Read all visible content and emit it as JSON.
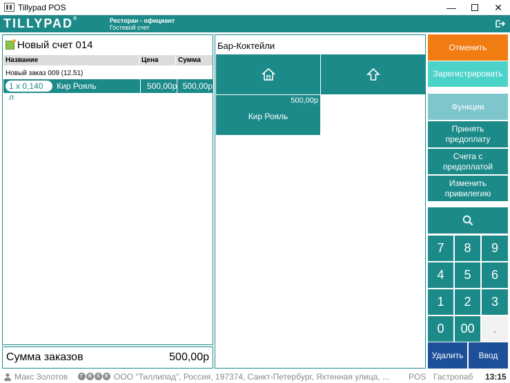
{
  "window": {
    "title": "Tillypad POS"
  },
  "header": {
    "logo": "TILLYPAD",
    "logo_mark": "®",
    "line1": "Ресторан - официант",
    "line2": "Гостевой счет"
  },
  "bill": {
    "title": "Новый счет 014",
    "columns": {
      "name": "Название",
      "price": "Цена",
      "sum": "Сумма"
    },
    "order_line": "Новый заказ 009 (12.51)",
    "items": [
      {
        "qty": "1 x 0,140 л",
        "name": "Кир Рояль",
        "price": "500,00р",
        "sum": "500,00р"
      }
    ]
  },
  "total": {
    "label": "Сумма заказов",
    "value": "500,00р"
  },
  "menu": {
    "category": "Бар-Коктейли",
    "product": {
      "price": "500,00р",
      "name": "Кир Рояль"
    }
  },
  "actions": {
    "cancel": "Отменить",
    "register": "Зарегистрировать",
    "functions": "Функции",
    "prepay_line1": "Принять",
    "prepay_line2": "предоплату",
    "prepaid_line1": "Счета с",
    "prepaid_line2": "предоплатой",
    "privilege_line1": "Изменить",
    "privilege_line2": "привилегию",
    "delete": "Удалить",
    "enter": "Ввод"
  },
  "keypad": {
    "k7": "7",
    "k8": "8",
    "k9": "9",
    "k4": "4",
    "k5": "5",
    "k6": "6",
    "k1": "1",
    "k2": "2",
    "k3": "3",
    "k0": "0",
    "k00": "00",
    "kdot": "."
  },
  "status": {
    "user": "Макс Золотов",
    "badges": [
      "Г",
      "В",
      "S",
      "Е"
    ],
    "company": "ООО \"Тиллипад\", Россия, 197374, Санкт-Петербург, Яхтенная улица, ...",
    "mode": "POS",
    "profile": "Гастропаб",
    "time": "13:15"
  },
  "colors": {
    "teal": "#1d8a8a",
    "cancel": "#f07c12",
    "register": "#4cd3c9",
    "functions": "#7fc5cc",
    "enter": "#1e4f99"
  }
}
